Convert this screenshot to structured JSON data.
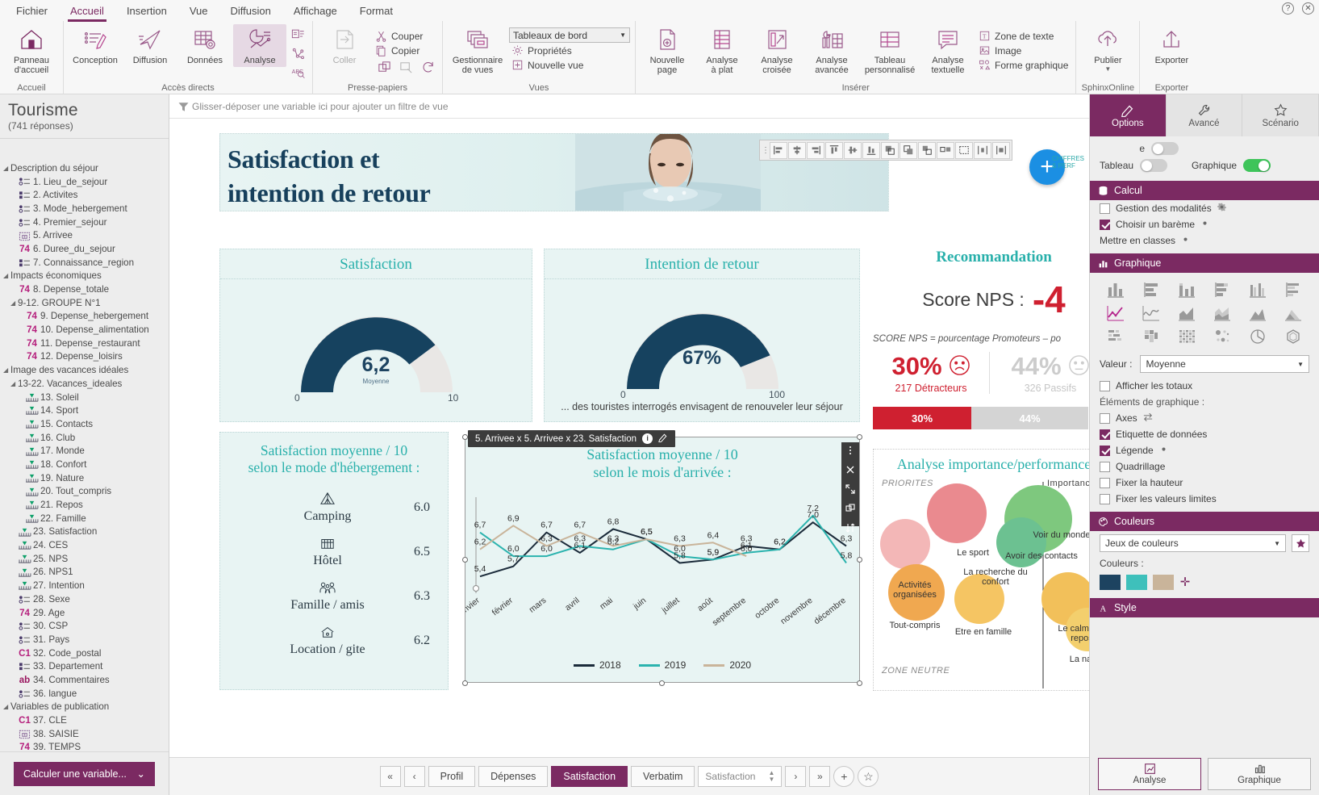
{
  "window": {
    "menu_tabs": [
      "Fichier",
      "Accueil",
      "Insertion",
      "Vue",
      "Diffusion",
      "Affichage",
      "Format"
    ],
    "active_menu": "Accueil",
    "help_icon": "help-icon",
    "close_icon": "close-icon"
  },
  "ribbon": {
    "groups": [
      {
        "title": "Accueil",
        "items": [
          {
            "label": "Panneau\nd'accueil",
            "icon": "home-icon"
          }
        ]
      },
      {
        "title": "Accès directs",
        "items": [
          {
            "label": "Conception",
            "icon": "design-pencil-icon"
          },
          {
            "label": "Diffusion",
            "icon": "paper-plane-icon"
          },
          {
            "label": "Données",
            "icon": "data-table-gear-icon"
          },
          {
            "label": "Analyse",
            "icon": "analysis-chart-icon",
            "selected": true
          }
        ],
        "mini": [
          "survey-chart-icon",
          "network-icon",
          "abc-search-icon"
        ]
      },
      {
        "title": "Presse-papiers",
        "items": [
          {
            "label": "Coller",
            "icon": "paste-icon",
            "disabled": true
          }
        ],
        "small": [
          {
            "label": "Couper",
            "icon": "scissors-icon"
          },
          {
            "label": "Copier",
            "icon": "copy-icon"
          }
        ],
        "mini2": [
          "duplicate-icon",
          "format-painter-icon",
          "reset-icon"
        ]
      },
      {
        "title": "Vues",
        "items": [
          {
            "label": "Gestionnaire\nde vues",
            "icon": "views-manager-icon"
          }
        ],
        "dropdown": "Tableaux de bord",
        "small": [
          {
            "label": "Propriétés",
            "icon": "gear-icon"
          },
          {
            "label": "Nouvelle vue",
            "icon": "plus-box-icon"
          }
        ]
      },
      {
        "title": "Insérer",
        "items": [
          {
            "label": "Nouvelle\npage",
            "icon": "new-page-icon"
          },
          {
            "label": "Analyse\nà plat",
            "icon": "flat-analysis-icon"
          },
          {
            "label": "Analyse\ncroisée",
            "icon": "cross-analysis-icon"
          },
          {
            "label": "Analyse\navancée",
            "icon": "advanced-analysis-icon"
          },
          {
            "label": "Tableau\npersonnalisé",
            "icon": "custom-table-icon"
          },
          {
            "label": "Analyse\ntextuelle",
            "icon": "text-analysis-icon"
          }
        ],
        "small": [
          {
            "label": "Zone de texte",
            "icon": "text-box-icon"
          },
          {
            "label": "Image",
            "icon": "image-icon"
          },
          {
            "label": "Forme graphique",
            "icon": "shape-icon"
          }
        ]
      },
      {
        "title": "SphinxOnline",
        "items": [
          {
            "label": "Publier",
            "icon": "cloud-upload-icon",
            "caret": true
          }
        ]
      },
      {
        "title": "Exporter",
        "items": [
          {
            "label": "Exporter",
            "icon": "export-arrow-icon"
          }
        ]
      }
    ]
  },
  "sidebar": {
    "title": "Tourisme",
    "subtitle": "(741 réponses)",
    "tree": [
      {
        "label": "Description du séjour",
        "depth": 0,
        "icon": "caret-icon"
      },
      {
        "label": "1. Lieu_de_sejour",
        "depth": 2,
        "icon": "single-choice-icon"
      },
      {
        "label": "2. Activites",
        "depth": 2,
        "icon": "multi-choice-icon"
      },
      {
        "label": "3. Mode_hebergement",
        "depth": 2,
        "icon": "single-choice-icon"
      },
      {
        "label": "4. Premier_sejour",
        "depth": 2,
        "icon": "single-choice-icon"
      },
      {
        "label": "5. Arrivee",
        "depth": 2,
        "icon": "date-icon"
      },
      {
        "label": "6. Duree_du_sejour",
        "depth": 2,
        "icon": "numeric-icon"
      },
      {
        "label": "7. Connaissance_region",
        "depth": 2,
        "icon": "multi-choice-icon"
      },
      {
        "label": "Impacts économiques",
        "depth": 0,
        "icon": "caret-icon"
      },
      {
        "label": "8. Depense_totale",
        "depth": 2,
        "icon": "numeric-icon"
      },
      {
        "label": "9-12. GROUPE N°1",
        "depth": 1,
        "icon": "caret-icon"
      },
      {
        "label": "9. Depense_hebergement",
        "depth": 3,
        "icon": "numeric-icon"
      },
      {
        "label": "10. Depense_alimentation",
        "depth": 3,
        "icon": "numeric-icon"
      },
      {
        "label": "11. Depense_restaurant",
        "depth": 3,
        "icon": "numeric-icon"
      },
      {
        "label": "12. Depense_loisirs",
        "depth": 3,
        "icon": "numeric-icon"
      },
      {
        "label": "Image des vacances idéales",
        "depth": 0,
        "icon": "caret-icon"
      },
      {
        "label": "13-22. Vacances_ideales",
        "depth": 1,
        "icon": "caret-icon"
      },
      {
        "label": "13. Soleil",
        "depth": 3,
        "icon": "scale-icon"
      },
      {
        "label": "14. Sport",
        "depth": 3,
        "icon": "scale-icon"
      },
      {
        "label": "15. Contacts",
        "depth": 3,
        "icon": "scale-icon"
      },
      {
        "label": "16. Club",
        "depth": 3,
        "icon": "scale-icon"
      },
      {
        "label": "17. Monde",
        "depth": 3,
        "icon": "scale-icon"
      },
      {
        "label": "18. Confort",
        "depth": 3,
        "icon": "scale-icon"
      },
      {
        "label": "19. Nature",
        "depth": 3,
        "icon": "scale-icon"
      },
      {
        "label": "20. Tout_compris",
        "depth": 3,
        "icon": "scale-icon"
      },
      {
        "label": "21. Repos",
        "depth": 3,
        "icon": "scale-icon"
      },
      {
        "label": "22. Famille",
        "depth": 3,
        "icon": "scale-icon"
      },
      {
        "label": "23. Satisfaction",
        "depth": 2,
        "icon": "scale-icon"
      },
      {
        "label": "24. CES",
        "depth": 2,
        "icon": "scale-icon"
      },
      {
        "label": "25. NPS",
        "depth": 2,
        "icon": "scale-icon"
      },
      {
        "label": "26. NPS1",
        "depth": 2,
        "icon": "scale-icon"
      },
      {
        "label": "27. Intention",
        "depth": 2,
        "icon": "scale-icon"
      },
      {
        "label": "28. Sexe",
        "depth": 2,
        "icon": "single-choice-icon"
      },
      {
        "label": "29. Age",
        "depth": 2,
        "icon": "numeric-icon"
      },
      {
        "label": "30. CSP",
        "depth": 2,
        "icon": "single-choice-icon"
      },
      {
        "label": "31. Pays",
        "depth": 2,
        "icon": "single-choice-icon"
      },
      {
        "label": "32. Code_postal",
        "depth": 2,
        "icon": "code-icon"
      },
      {
        "label": "33. Departement",
        "depth": 2,
        "icon": "multi-choice-icon"
      },
      {
        "label": "34. Commentaires",
        "depth": 2,
        "icon": "text-icon"
      },
      {
        "label": "36. langue",
        "depth": 2,
        "icon": "single-choice-icon"
      },
      {
        "label": "Variables de publication",
        "depth": 0,
        "icon": "caret-icon"
      },
      {
        "label": "37. CLE",
        "depth": 2,
        "icon": "code-icon"
      },
      {
        "label": "38. SAISIE",
        "depth": 2,
        "icon": "date-icon"
      },
      {
        "label": "39. TEMPS",
        "depth": 2,
        "icon": "numeric-icon"
      }
    ],
    "calc_button": "Calculer une variable...",
    "calc_caret": "chevron-down-icon"
  },
  "filterbar": {
    "icon": "filter-icon",
    "text": "Glisser-déposer une variable ici pour ajouter un filtre de vue"
  },
  "banner": {
    "line1": "Satisfaction et",
    "line2": "intention de retour"
  },
  "align_toolbar": {
    "buttons": [
      "align-left-icon",
      "align-center-h-icon",
      "align-right-icon",
      "align-top-icon",
      "align-middle-icon",
      "align-bottom-icon",
      "bring-front-icon",
      "send-back-icon",
      "group-icon",
      "ungroup-icon",
      "fit-icon",
      "distribute-h-icon",
      "distribute-v-icon"
    ]
  },
  "fab": {
    "icon": "plus-icon",
    "side_text_1": "CHIFFRES",
    "side_text_2": "& PERF"
  },
  "cards": {
    "satisfaction": {
      "title": "Satisfaction",
      "value": "6,2",
      "sublabel": "Moyenne",
      "min": "0",
      "max": "10",
      "percent_filled": 62
    },
    "intention": {
      "title": "Intention de retour",
      "value": "67%",
      "min": "0",
      "max": "100",
      "percent_filled": 67,
      "footer": "... des touristes interrogés envisagent de renouveler leur séjour"
    },
    "hebergement": {
      "title_line1": "Satisfaction moyenne / 10",
      "title_line2": "selon le mode d'hébergement :",
      "rows": [
        {
          "label": "Camping",
          "value": "6.0",
          "icon": "tent-icon"
        },
        {
          "label": "Hôtel",
          "value": "6.5",
          "icon": "hotel-icon"
        },
        {
          "label": "Famille / amis",
          "value": "6.3",
          "icon": "family-icon"
        },
        {
          "label": "Location / gite",
          "value": "6.2",
          "icon": "house-key-icon"
        }
      ]
    },
    "recommandation": {
      "title": "Recommandation",
      "score_label": "Score NPS :",
      "score_value": "-4",
      "formula": "SCORE NPS = pourcentage Promoteurs – po",
      "segments": [
        {
          "pct": "30%",
          "count": "217 Détracteurs",
          "face": "sad-face-icon",
          "color": "#cf2030"
        },
        {
          "pct": "44%",
          "count": "326 Passifs",
          "face": "neutral-face-icon",
          "color": "#c6c6c6"
        }
      ],
      "bars": [
        {
          "label": "30%",
          "color": "#cf2030",
          "width": 122
        },
        {
          "label": "44%",
          "color": "#d4d4d4",
          "width": 140
        }
      ]
    },
    "importance": {
      "title": "Analyse importance/performance",
      "quad_topleft": "PRIORITES",
      "quad_bottomleft": "ZONE NEUTRE",
      "axis_label": "Importance",
      "bubbles": [
        {
          "label": "Le sport",
          "color": "#ea8a8f",
          "x": 86,
          "y": 28,
          "r": 42
        },
        {
          "label": "Voir du monde",
          "color": "#7ec87e",
          "x": 186,
          "y": 30,
          "r": 48
        },
        {
          "label": "Avoir des contacts",
          "color": "#6cc191",
          "x": 168,
          "y": 66,
          "r": 30
        },
        {
          "label": "La recherche du confort",
          "color": "#f3b7b7",
          "x": 22,
          "y": 70,
          "r": 34
        },
        {
          "label": "Activités organisées",
          "color": "#f0a850",
          "x": 30,
          "y": 120,
          "r": 38
        },
        {
          "label": "Tout-compris",
          "color": "#f3c23f",
          "x": 16,
          "y": 146,
          "r": 22
        },
        {
          "label": "Etre en famille",
          "color": "#f5c563",
          "x": 118,
          "y": 128,
          "r": 32
        },
        {
          "label": "Le calme, le repos",
          "color": "#f2c05a",
          "x": 228,
          "y": 132,
          "r": 34
        },
        {
          "label": "La nature",
          "color": "#f3cf6d",
          "x": 244,
          "y": 166,
          "r": 26
        }
      ]
    }
  },
  "chart_panel": {
    "tooltip": "5. Arrivee x 5. Arrivee x 23. Satisfaction",
    "tooltip_info_icon": "info-icon",
    "tooltip_edit_icon": "pencil-icon",
    "context_icons": [
      "more-vertical-icon",
      "close-icon",
      "expand-icon",
      "duplicate-icon",
      "sort-icon"
    ]
  },
  "chart_data": {
    "type": "line",
    "title": "Satisfaction moyenne / 10\nselon le mois d'arrivée :",
    "title_line1": "Satisfaction moyenne / 10",
    "title_line2": "selon le mois d'arrivée :",
    "xlabel": "",
    "ylabel": "",
    "ylim": [
      5.0,
      7.6
    ],
    "grid": false,
    "legend_position": "bottom",
    "categories": [
      "janvier",
      "février",
      "mars",
      "avril",
      "mai",
      "juin",
      "juillet",
      "août",
      "septembre",
      "octobre",
      "novembre",
      "décembre"
    ],
    "series": [
      {
        "name": "2018",
        "color": "#1b2b3a",
        "values": [
          5.4,
          5.7,
          6.7,
          6.1,
          6.8,
          6.5,
          5.8,
          5.9,
          6.3,
          6.2,
          7.0,
          6.3
        ],
        "labels": [
          "5,4",
          "5,7",
          "6,7",
          "6,1",
          "6,8",
          "6,5",
          "5,8",
          "5,9",
          "6,3",
          "6,2",
          "7,0",
          "6,3"
        ]
      },
      {
        "name": "2019",
        "color": "#2bb3ae",
        "values": [
          6.7,
          6.0,
          6.0,
          6.3,
          6.2,
          6.5,
          6.0,
          5.9,
          6.1,
          6.2,
          7.2,
          5.8
        ],
        "labels": [
          "6,7",
          "6,0",
          "6,0",
          "6,3",
          "6,2",
          "6,5",
          "6,0",
          "5,9",
          "6,1",
          "6,2",
          "7,2",
          "5,8"
        ]
      },
      {
        "name": "2020",
        "color": "#c9b49a",
        "values": [
          6.2,
          6.9,
          6.3,
          6.7,
          6.3,
          6.5,
          6.3,
          6.4,
          6.0,
          null,
          null,
          null
        ],
        "labels": [
          "6,2",
          "6,9",
          "6,3",
          "6,7",
          "6,3",
          "6,5",
          "6,3",
          "6,4",
          "6,0",
          "",
          "",
          ""
        ]
      }
    ],
    "legend": [
      "2018",
      "2019",
      "2020"
    ]
  },
  "right_panel": {
    "tabs": [
      {
        "label": "Options",
        "icon": "pencil-icon",
        "active": true
      },
      {
        "label": "Avancé",
        "icon": "wrench-icon",
        "active": false
      },
      {
        "label": "Scénario",
        "icon": "star-icon",
        "active": false
      }
    ],
    "toggles": [
      {
        "label": "Tableau",
        "on": false
      },
      {
        "label": "Graphique",
        "on": true
      }
    ],
    "hidden_toggle_label": "e",
    "sections": {
      "calcul": {
        "title": "Calcul",
        "icon": "database-icon",
        "rows": [
          {
            "label": "Gestion des modalités",
            "checked": false,
            "gear": true
          },
          {
            "label": "Choisir un barème",
            "checked": true,
            "gear": true
          },
          {
            "label": "Mettre en classes",
            "checked": null,
            "gear": true
          }
        ]
      },
      "graphique": {
        "title": "Graphique",
        "icon": "bar-chart-icon",
        "chart_types": [
          {
            "name": "column-chart-icon",
            "selected": false
          },
          {
            "name": "bar-chart-h-icon",
            "selected": false
          },
          {
            "name": "stacked-column-icon",
            "selected": false
          },
          {
            "name": "stacked-bar-icon",
            "selected": false
          },
          {
            "name": "grouped-column-icon",
            "selected": false
          },
          {
            "name": "grouped-bar-icon",
            "selected": false
          },
          {
            "name": "line-chart-icon",
            "selected": true
          },
          {
            "name": "spline-chart-icon",
            "selected": false
          },
          {
            "name": "area-chart-icon",
            "selected": false
          },
          {
            "name": "stacked-area-icon",
            "selected": false
          },
          {
            "name": "mountain-chart-icon",
            "selected": false
          },
          {
            "name": "layered-area-icon",
            "selected": false
          },
          {
            "name": "heatmap-icon",
            "selected": false
          },
          {
            "name": "treemap-icon",
            "selected": false
          },
          {
            "name": "mosaic-icon",
            "selected": false
          },
          {
            "name": "bubble-chart-icon",
            "selected": false
          },
          {
            "name": "pie-chart-icon",
            "selected": false
          },
          {
            "name": "radar-chart-icon",
            "selected": false
          }
        ],
        "value_label": "Valeur :",
        "value_selected": "Moyenne",
        "show_totals": {
          "label": "Afficher les totaux",
          "checked": false
        },
        "elements_label": "Éléments de graphique :",
        "elements": [
          {
            "label": "Axes",
            "checked": false,
            "extra": "swap-icon"
          },
          {
            "label": "Etiquette de données",
            "checked": true
          },
          {
            "label": "Légende",
            "checked": true,
            "gear": true
          },
          {
            "label": "Quadrillage",
            "checked": false
          },
          {
            "label": "Fixer la hauteur",
            "checked": false
          },
          {
            "label": "Fixer les valeurs limites",
            "checked": false
          }
        ]
      },
      "couleurs": {
        "title": "Couleurs",
        "icon": "palette-icon",
        "palette_label": "Jeux de couleurs",
        "colors_label": "Couleurs :",
        "swatches": [
          "#1d4360",
          "#3ec0bb",
          "#c9b49a"
        ],
        "add_icon": "plus-icon",
        "star_icon": "star-icon"
      },
      "style": {
        "title": "Style",
        "icon": "letter-a-icon"
      }
    },
    "bottom_tabs": [
      {
        "label": "Analyse",
        "icon": "analysis-icon",
        "active": true
      },
      {
        "label": "Graphique",
        "icon": "chart-icon",
        "active": false
      }
    ]
  },
  "bottom_bar": {
    "nav": [
      "«",
      "‹"
    ],
    "pages": [
      {
        "label": "Profil",
        "active": false
      },
      {
        "label": "Dépenses",
        "active": false
      },
      {
        "label": "Satisfaction",
        "active": true
      },
      {
        "label": "Verbatim",
        "active": false
      }
    ],
    "selector_value": "Satisfaction",
    "nav_right": [
      "›",
      "»"
    ],
    "add_icon": "plus-icon",
    "fav_icon": "star-icon"
  }
}
